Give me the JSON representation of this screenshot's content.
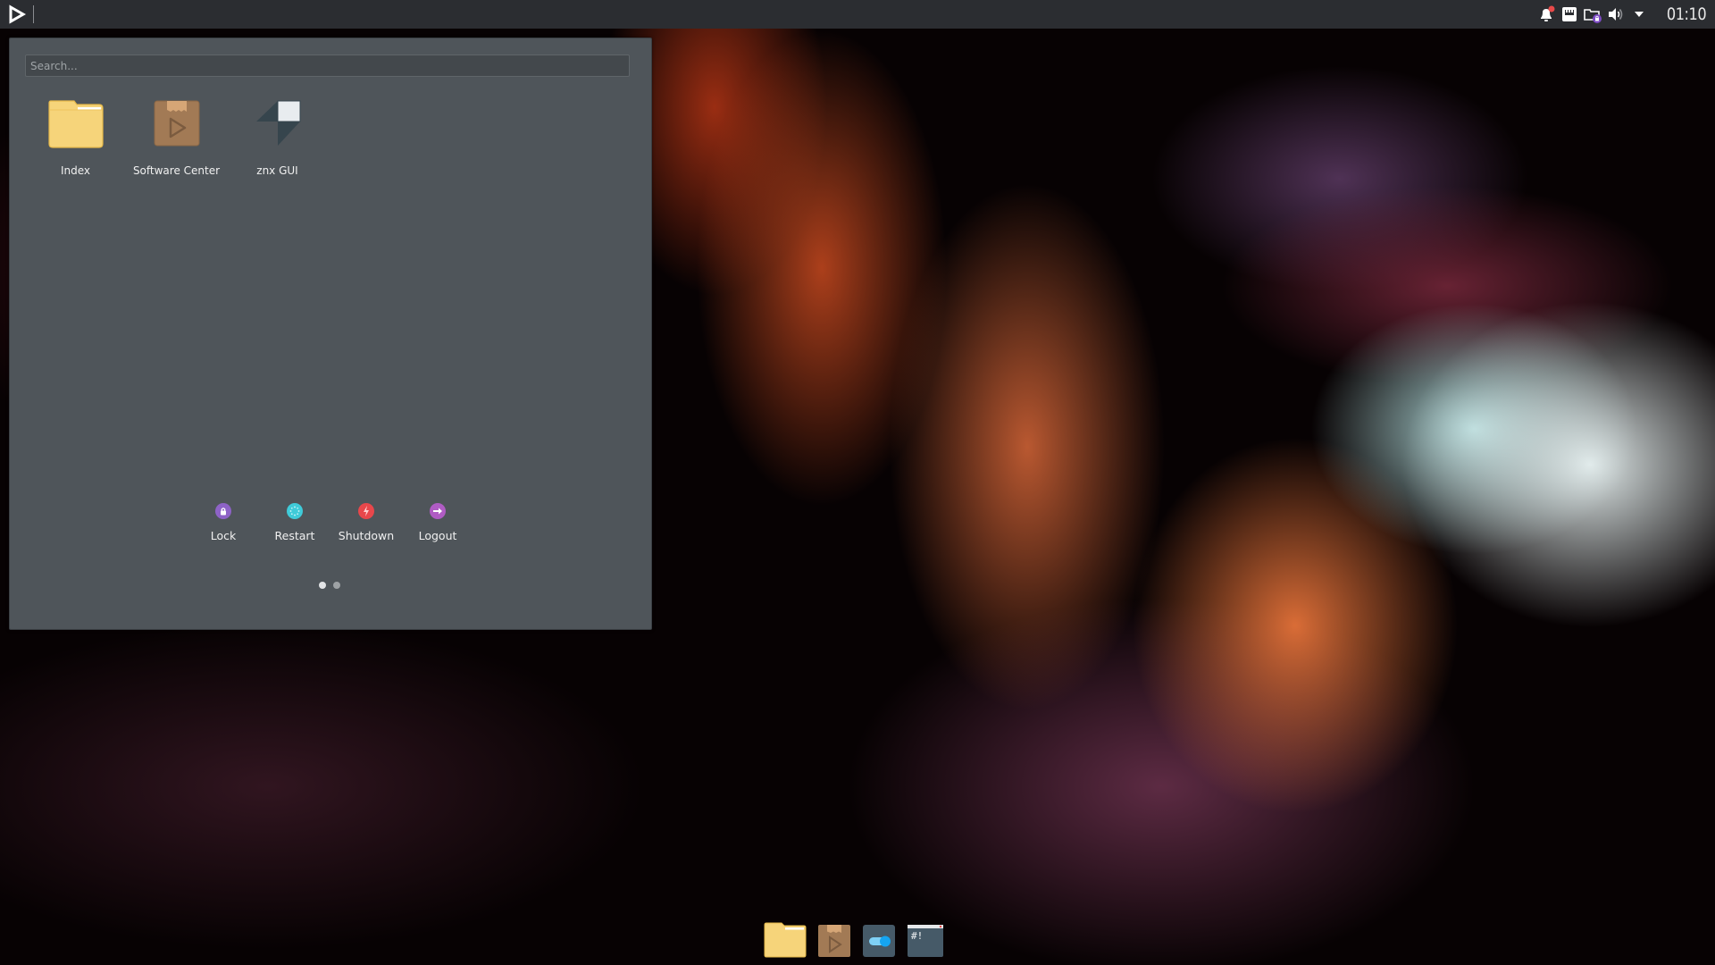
{
  "topbar": {
    "launcher_icon": "play-triangle-icon",
    "tray_icons": [
      "notification-bell-icon",
      "network-ethernet-icon",
      "folder-lock-icon",
      "volume-icon",
      "dropdown-arrow-icon"
    ],
    "notification_badge_color": "#e84a4a",
    "clock": "01:10"
  },
  "launcher": {
    "search_placeholder": "Search...",
    "search_value": "",
    "apps": [
      {
        "label": "Index",
        "icon": "folder-icon"
      },
      {
        "label": "Software Center",
        "icon": "package-icon"
      },
      {
        "label": "znx GUI",
        "icon": "znx-icon"
      }
    ],
    "power_actions": [
      {
        "label": "Lock",
        "icon": "lock-icon",
        "color": "#8e63c7"
      },
      {
        "label": "Restart",
        "icon": "restart-icon",
        "color": "#3fcbd9"
      },
      {
        "label": "Shutdown",
        "icon": "power-icon",
        "color": "#e8474b"
      },
      {
        "label": "Logout",
        "icon": "logout-icon",
        "color": "#b05cc4"
      }
    ],
    "pages": {
      "current": 1,
      "total": 2
    }
  },
  "dock": {
    "items": [
      {
        "name": "file-manager",
        "icon": "folder-icon"
      },
      {
        "name": "software-center",
        "icon": "package-icon"
      },
      {
        "name": "settings",
        "icon": "toggle-icon"
      },
      {
        "name": "terminal",
        "icon": "terminal-icon",
        "glyph": "#!"
      }
    ]
  }
}
